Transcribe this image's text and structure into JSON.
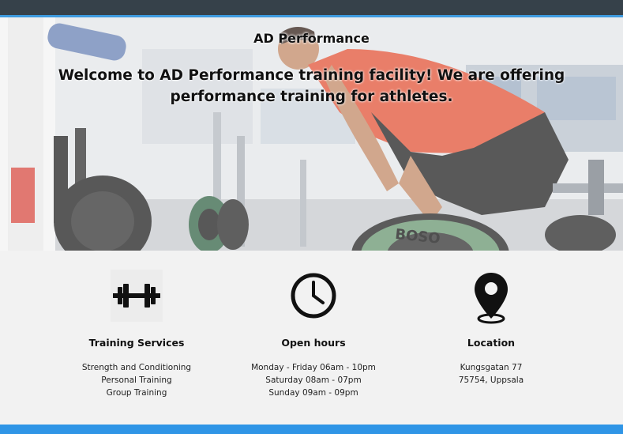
{
  "header": {
    "brand": "AD Performance",
    "headline_line1": "Welcome to AD Performance training facility! We are offering",
    "headline_line2": "performance training for athletes."
  },
  "features": [
    {
      "icon": "dumbbell-icon",
      "title": "Training Services",
      "lines": [
        "Strength and Conditioning",
        "Personal Training",
        "Group Training"
      ]
    },
    {
      "icon": "clock-icon",
      "title": "Open hours",
      "lines": [
        "Monday - Friday 06am - 10pm",
        "Saturday 08am - 07pm",
        "Sunday 09am - 09pm"
      ]
    },
    {
      "icon": "location-pin-icon",
      "title": "Location",
      "lines": [
        "Kungsgatan 77",
        "75754, Uppsala"
      ]
    }
  ],
  "colors": {
    "top_bar": "#36414a",
    "accent_blue": "#2f95e6",
    "feature_bg": "#f2f2f2"
  }
}
